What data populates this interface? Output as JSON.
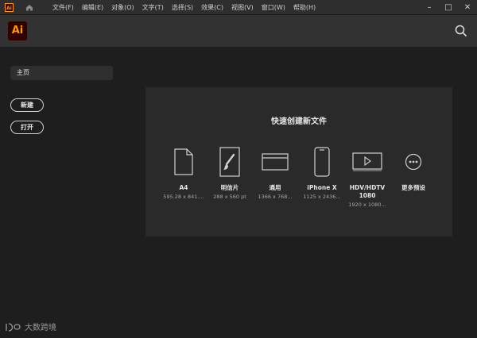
{
  "app": {
    "mini_logo": "Ai",
    "logo": "Ai"
  },
  "menu": {
    "items": [
      "文件(F)",
      "编辑(E)",
      "对象(O)",
      "文字(T)",
      "选择(S)",
      "效果(C)",
      "视图(V)",
      "窗口(W)",
      "帮助(H)"
    ]
  },
  "window_controls": {
    "minimize": "–",
    "maximize": "□",
    "close": "✕"
  },
  "sidebar": {
    "home_label": "主页",
    "new_label": "新建",
    "open_label": "打开"
  },
  "quick_create": {
    "title": "快速创建新文件",
    "presets": [
      {
        "name": "A4",
        "size": "595.28 x 841....",
        "icon": "document-icon"
      },
      {
        "name": "明信片",
        "size": "288 x 560 pt",
        "icon": "postcard-brush-icon"
      },
      {
        "name": "通用",
        "size": "1366 x 768...",
        "icon": "screen-wide-icon"
      },
      {
        "name": "iPhone X",
        "size": "1125 x 2436...",
        "icon": "phone-icon"
      },
      {
        "name": "HDV/HDTV 1080",
        "size": "1920 x 1080...",
        "icon": "video-play-icon"
      },
      {
        "name": "更多预设",
        "size": "",
        "icon": "more-dots-icon"
      }
    ]
  },
  "watermark": {
    "text": "大数跨境"
  },
  "colors": {
    "accent": "#ff9a00",
    "logo_bg": "#330000"
  }
}
